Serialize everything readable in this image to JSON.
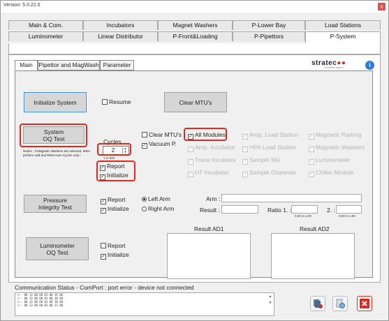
{
  "window": {
    "title": "Version: 5.0.22.0",
    "close_label": "x"
  },
  "tabs_row1": [
    "Main & Com.",
    "Incubators",
    "Magnet Washers",
    "P-Lower Bay",
    "Load Stations"
  ],
  "tabs_row2": [
    "Luminometer",
    "Linear Distributor",
    "P-Front&Loading",
    "P-Pipettors",
    "P-System"
  ],
  "subtabs": [
    "Main",
    "Pipettor and MagWash",
    "Parameter"
  ],
  "logo": {
    "text": "stratec",
    "tagline": "innovation system"
  },
  "info_icon": "info-icon",
  "buttons": {
    "initialize_system": "Initialize System",
    "clear_mtus": "Clear MTU's",
    "system_oq_line1": "System",
    "system_oq_line2": "OQ Test",
    "pressure_line1": "Pressure",
    "pressure_line2": "Integrity Test",
    "lumi_line1": "Luminometer",
    "lumi_line2": "OQ Test"
  },
  "resume_label": "Resume",
  "system_oq": {
    "note": "Notice : If Magnetic Washers are selected, MW1 perform odd and MW2 even Cycles only !",
    "cycles_label": "Cycles",
    "cycles_value": "2",
    "cycles_range": "1 to 500",
    "report_label": "Report",
    "initialize_label": "Initialize",
    "clear_mtus_label": "Clear MTU's",
    "vacuum_label": "Vacuum P.",
    "all_modules_label": "All Modules",
    "modules": [
      "Amp. Load Station",
      "Magnetic Parking",
      "Amp. Incubator",
      "HPA Load Station",
      "Magnetic Washers",
      "Trans Incubator",
      "Sample Mix",
      "Luminometer",
      "HT Incubator",
      "Sample Dispense",
      "Chiller Module"
    ]
  },
  "pressure": {
    "report_label": "Report",
    "initialize_label": "Initialize",
    "left_arm_label": "Left Arm",
    "right_arm_label": "Right Arm",
    "arm_label": "Arm :",
    "result_label": "Result :",
    "ratio1_label": "Ratio 1. :",
    "ratio2_label": "2. :",
    "range1": "0.50 to 1.00",
    "range2": "0.50 to 1.00"
  },
  "luminometer": {
    "report_label": "Report",
    "initialize_label": "Initialize",
    "result_ad1": "Result AD1",
    "result_ad2": "Result AD2"
  },
  "status": {
    "text": "Communication Status - ComPort : port error - device not connected"
  },
  "log_lines": [
    "<-- 00 13 00 00 01 00 1E 00",
    "<-- 00 13 00 00 01 00 1B 00",
    "<-- 00 13 00 00 01 00 1B 00",
    "<-- 00 13 00 00 01 00 15 00"
  ],
  "action_icons": [
    "database-icon",
    "settings-icon",
    "close-icon"
  ],
  "colors": {
    "highlight": "#e0281e",
    "accent": "#3c8fd8",
    "close": "#d9534f"
  }
}
